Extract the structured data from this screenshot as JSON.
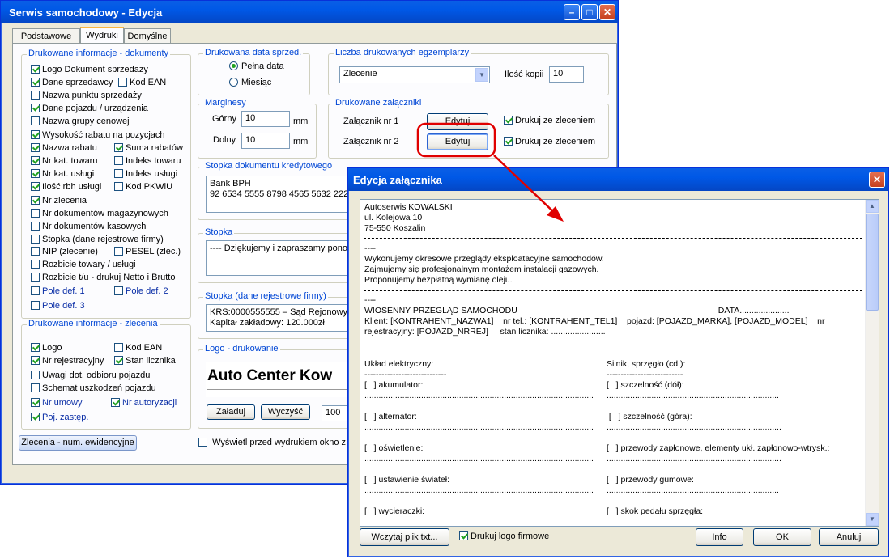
{
  "main_window": {
    "title": "Serwis samochodowy - Edycja",
    "tabs": [
      "Podstawowe",
      "Wydruki",
      "Domyślne"
    ],
    "group_docs": {
      "title": "Drukowane informacje - dokumenty",
      "items": [
        {
          "label": "Logo Dokument sprzedaży",
          "checked": true
        },
        {
          "label": "Dane sprzedawcy",
          "checked": true
        },
        {
          "label": "Kod EAN",
          "checked": false
        },
        {
          "label": "Nazwa punktu sprzedaży",
          "checked": false
        },
        {
          "label": "Dane pojazdu / urządzenia",
          "checked": true
        },
        {
          "label": "Nazwa grupy cenowej",
          "checked": false
        },
        {
          "label": "Wysokość rabatu na pozycjach",
          "checked": true
        },
        {
          "label": "Nazwa rabatu",
          "checked": true
        },
        {
          "label": "Suma rabatów",
          "checked": true
        },
        {
          "label": "Nr kat. towaru",
          "checked": true
        },
        {
          "label": "Indeks towaru",
          "checked": false
        },
        {
          "label": "Nr kat. usługi",
          "checked": true
        },
        {
          "label": "Indeks usługi",
          "checked": false
        },
        {
          "label": "Ilość rbh usługi",
          "checked": true
        },
        {
          "label": "Kod PKWiU",
          "checked": false
        },
        {
          "label": "Nr zlecenia",
          "checked": true
        },
        {
          "label": "Nr dokumentów magazynowych",
          "checked": false
        },
        {
          "label": "Nr dokumentów kasowych",
          "checked": false
        },
        {
          "label": "Stopka (dane rejestrowe firmy)",
          "checked": false
        },
        {
          "label": "NIP (zlecenie)",
          "checked": false
        },
        {
          "label": "PESEL (zlec.)",
          "checked": false
        },
        {
          "label": "Rozbicie towary / usługi",
          "checked": false
        },
        {
          "label": "Rozbicie t/u - drukuj Netto i Brutto",
          "checked": false
        },
        {
          "label": "Pole def. 1",
          "checked": false
        },
        {
          "label": "Pole def. 2",
          "checked": false
        },
        {
          "label": "Pole def. 3",
          "checked": false
        }
      ]
    },
    "group_orders": {
      "title": "Drukowane informacje - zlecenia",
      "items": [
        {
          "label": "Logo",
          "checked": true
        },
        {
          "label": "Kod EAN",
          "checked": false
        },
        {
          "label": "Nr rejestracyjny",
          "checked": true
        },
        {
          "label": "Stan licznika",
          "checked": true
        },
        {
          "label": "Uwagi dot. odbioru pojazdu",
          "checked": false
        },
        {
          "label": "Schemat uszkodzeń pojazdu",
          "checked": false
        },
        {
          "label": "Nr umowy",
          "checked": true
        },
        {
          "label": "Nr autoryzacji",
          "checked": true
        },
        {
          "label": "Poj. zastęp.",
          "checked": true
        }
      ]
    },
    "orders_button": "Zlecenia - num. ewidencyjne",
    "print_date": {
      "title": "Drukowana data sprzed.",
      "options": [
        "Pełna data",
        "Miesiąc"
      ],
      "selected": "Pełna data"
    },
    "margins": {
      "title": "Marginesy",
      "top_label": "Górny",
      "top_value": "10",
      "bottom_label": "Dolny",
      "bottom_value": "10",
      "unit": "mm"
    },
    "copies": {
      "title": "Liczba drukowanych egzemplarzy",
      "select_value": "Zlecenie",
      "count_label": "Ilość kopii",
      "count_value": "10"
    },
    "attachments": {
      "title": "Drukowane załączniki",
      "rows": [
        {
          "label": "Załącznik nr 1",
          "button": "Edytuj",
          "check": "Drukuj ze zleceniem",
          "checked": true
        },
        {
          "label": "Załącznik nr 2",
          "button": "Edytuj",
          "check": "Drukuj ze zleceniem",
          "checked": true
        }
      ]
    },
    "credit_footer": {
      "title": "Stopka dokumentu kredytowego",
      "lines": [
        "Bank BPH",
        "92 6534 5555 8798 4565 5632 2222"
      ]
    },
    "footer": {
      "title": "Stopka",
      "text": "---- Dziękujemy i zapraszamy ponow"
    },
    "reg_footer": {
      "title": "Stopka (dane rejestrowe firmy)",
      "lines": [
        "KRS:0000555555 – Sąd Rejonowy w",
        "Kapitał zakładowy: 120.000zł"
      ]
    },
    "logo": {
      "title": "Logo - drukowanie",
      "preview_text": "Auto Center Kow",
      "load_button": "Załaduj",
      "clear_button": "Wyczyść",
      "value": "100"
    },
    "preview_check": {
      "label": "Wyświetl przed wydrukiem okno z w",
      "checked": false
    }
  },
  "dialog": {
    "title": "Edycja załącznika",
    "text_blocks": {
      "header": "Autoserwis KOWALSKI\nul. Kolejowa 10\n75-550 Koszalin",
      "intro": "----\nWykonujemy okresowe przeglądy eksploatacyjne samochodów.\nZajmujemy się profesjonalnym montażem instalacji gazowych.\nProponujemy bezpłatną wymianę oleju.",
      "inspection": "----\nWIOSENNY PRZEGLĄD SAMOCHODU                                                                                     DATA.....................\nKlient: [KONTRAHENT_NAZWA1]    nr tel.: [KONTRAHENT_TEL1]    pojazd: [POJAZD_MARKA], [POJAZD_MODEL]    nr\nrejestracyjny: [POJAZD_NRREJ]     stan licznika: .......................",
      "checklist_left": "Układ elektryczny:\n-----------------------------\n[   ] akumulator:\n.................................................................................................\n\n[   ] alternator:\n.................................................................................................\n\n[   ] oświetlenie:\n.................................................................................................\n\n[   ] ustawienie świateł:\n.................................................................................................\n\n[   ] wycieraczki:",
      "checklist_right": "Silnik, sprzęgło (cd.):\n---------------------------\n[   ] szczelność (dół):\n.........................................................................\n\n [   ] szczelność (góra):\n..........................................................................\n\n[   ] przewody zapłonowe, elementy ukł. zapłonowo-wtrysk.:\n..........................................................................\n\n[   ] przewody gumowe:\n.........................................................................\n\n[   ] skok pedału sprzęgła:"
    },
    "load_button": "Wczytaj plik txt...",
    "logo_check": {
      "label": "Drukuj logo firmowe",
      "checked": true
    },
    "info_button": "Info",
    "ok_button": "OK",
    "cancel_button": "Anuluj"
  }
}
